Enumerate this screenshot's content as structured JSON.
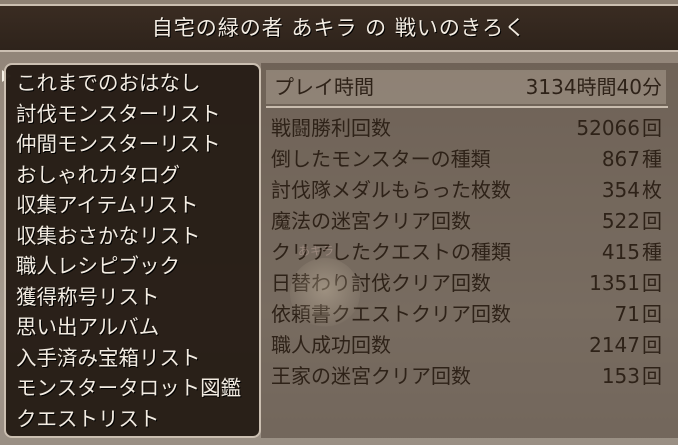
{
  "title": "自宅の緑の者 あキラ の 戦いのきろく",
  "menu": {
    "items": [
      {
        "label": "これまでのおはなし"
      },
      {
        "label": "討伐モンスターリスト"
      },
      {
        "label": "仲間モンスターリスト"
      },
      {
        "label": "おしゃれカタログ"
      },
      {
        "label": "収集アイテムリスト"
      },
      {
        "label": "収集おさかなリスト"
      },
      {
        "label": "職人レシピブック"
      },
      {
        "label": "獲得称号リスト"
      },
      {
        "label": "思い出アルバム"
      },
      {
        "label": "入手済み宝箱リスト"
      },
      {
        "label": "モンスタータロット図鑑"
      },
      {
        "label": "クエストリスト"
      }
    ]
  },
  "stats": {
    "playtime": {
      "label": "プレイ時間",
      "value": "3134時間40分"
    },
    "rows": [
      {
        "label": "戦闘勝利回数",
        "value": "52066",
        "unit": "回"
      },
      {
        "label": "倒したモンスターの種類",
        "value": "867",
        "unit": "種"
      },
      {
        "label": "討伐隊メダルもらった枚数",
        "value": "354",
        "unit": "枚"
      },
      {
        "label": "魔法の迷宮クリア回数",
        "value": "522",
        "unit": "回"
      },
      {
        "label": "クリアしたクエストの種類",
        "value": "415",
        "unit": "種"
      },
      {
        "label": "日替わり討伐クリア回数",
        "value": "1351",
        "unit": "回"
      },
      {
        "label": "依頼書クエストクリア回数",
        "value": "71",
        "unit": "回"
      },
      {
        "label": "職人成功回数",
        "value": "2147",
        "unit": "回"
      },
      {
        "label": "王家の迷宮クリア回数",
        "value": "153",
        "unit": "回"
      }
    ]
  },
  "watermark": "あキラ",
  "colors": {
    "panel_dark": "#241b14",
    "border": "#cbbfb1",
    "text_light": "#f3ece2",
    "text_dark": "#2e2218"
  }
}
